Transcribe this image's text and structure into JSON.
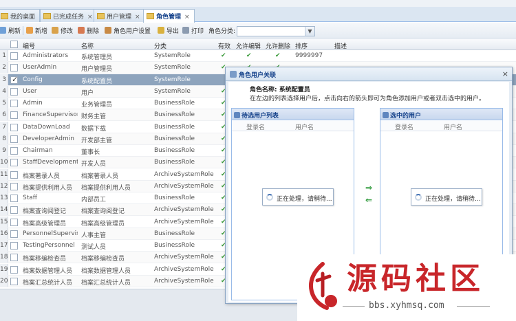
{
  "tabs": [
    {
      "label": "我的桌面",
      "closable": false
    },
    {
      "label": "已完成任务",
      "closable": true
    },
    {
      "label": "用户管理",
      "closable": true
    },
    {
      "label": "角色管理",
      "closable": true,
      "active": true
    }
  ],
  "toolbar": {
    "refresh": "刷新",
    "add": "新增",
    "edit": "修改",
    "delete": "删除",
    "role_user_settings": "角色用户设置",
    "export": "导出",
    "print": "打印",
    "category_label": "角色分类:",
    "category_value": ""
  },
  "grid": {
    "columns": {
      "code": "编号",
      "name": "名称",
      "category": "分类",
      "enabled": "有效",
      "allow_edit": "允许编辑",
      "allow_delete": "允许删除",
      "sort": "排序",
      "description": "描述"
    },
    "rows": [
      {
        "num": "1",
        "code": "Administrators",
        "name": "系统管理员",
        "category": "SystemRole",
        "enabled": "✔",
        "allow_edit": "✔",
        "allow_delete": "✔",
        "sort": "9999997",
        "description": ""
      },
      {
        "num": "2",
        "code": "UserAdmin",
        "name": "用户管理员",
        "category": "SystemRole",
        "enabled": "✔",
        "allow_edit": "✔",
        "allow_delete": "✔",
        "sort": "",
        "description": ""
      },
      {
        "num": "3",
        "code": "Config",
        "name": "系统配置员",
        "category": "SystemRole",
        "enabled": "",
        "allow_edit": "",
        "allow_delete": "",
        "sort": "",
        "description": "",
        "selected": true
      },
      {
        "num": "4",
        "code": "User",
        "name": "用户",
        "category": "SystemRole",
        "enabled": "✔",
        "allow_edit": "",
        "allow_delete": "",
        "sort": "",
        "description": ""
      },
      {
        "num": "5",
        "code": "Admin",
        "name": "业务管理员",
        "category": "BusinessRole",
        "enabled": "✔",
        "allow_edit": "",
        "allow_delete": "",
        "sort": "",
        "description": ""
      },
      {
        "num": "6",
        "code": "FinanceSupervisor",
        "name": "财务主管",
        "category": "BusinessRole",
        "enabled": "✔",
        "allow_edit": "",
        "allow_delete": "",
        "sort": "",
        "description": ""
      },
      {
        "num": "7",
        "code": "DataDownLoad",
        "name": "数据下载",
        "category": "BusinessRole",
        "enabled": "✔",
        "allow_edit": "",
        "allow_delete": "",
        "sort": "",
        "description": ""
      },
      {
        "num": "8",
        "code": "DeveloperAdmin",
        "name": "开发部主管",
        "category": "BusinessRole",
        "enabled": "✔",
        "allow_edit": "",
        "allow_delete": "",
        "sort": "",
        "description": ""
      },
      {
        "num": "9",
        "code": "Chairman",
        "name": "董事长",
        "category": "BusinessRole",
        "enabled": "✔",
        "allow_edit": "",
        "allow_delete": "",
        "sort": "",
        "description": ""
      },
      {
        "num": "10",
        "code": "StaffDevelopment",
        "name": "开发人员",
        "category": "BusinessRole",
        "enabled": "✔",
        "allow_edit": "",
        "allow_delete": "",
        "sort": "",
        "description": ""
      },
      {
        "num": "11",
        "code": "档案著录人员",
        "name": "档案著录人员",
        "category": "ArchiveSystemRole",
        "enabled": "✔",
        "allow_edit": "",
        "allow_delete": "",
        "sort": "",
        "description": ""
      },
      {
        "num": "12",
        "code": "档案提供利用人员",
        "name": "档案提供利用人员",
        "category": "ArchiveSystemRole",
        "enabled": "✔",
        "allow_edit": "",
        "allow_delete": "",
        "sort": "",
        "description": ""
      },
      {
        "num": "13",
        "code": "Staff",
        "name": "内部员工",
        "category": "BusinessRole",
        "enabled": "✔",
        "allow_edit": "",
        "allow_delete": "",
        "sort": "",
        "description": ""
      },
      {
        "num": "14",
        "code": "档案查询阅登记",
        "name": "档案查询阅登记",
        "category": "ArchiveSystemRole",
        "enabled": "✔",
        "allow_edit": "",
        "allow_delete": "",
        "sort": "",
        "description": ""
      },
      {
        "num": "15",
        "code": "档案高级管理员",
        "name": "档案高级管理员",
        "category": "ArchiveSystemRole",
        "enabled": "✔",
        "allow_edit": "",
        "allow_delete": "",
        "sort": "",
        "description": ""
      },
      {
        "num": "16",
        "code": "PersonnelSupervisor",
        "name": "人事主管",
        "category": "BusinessRole",
        "enabled": "✔",
        "allow_edit": "",
        "allow_delete": "",
        "sort": "",
        "description": ""
      },
      {
        "num": "17",
        "code": "TestingPersonnel",
        "name": "测试人员",
        "category": "BusinessRole",
        "enabled": "✔",
        "allow_edit": "",
        "allow_delete": "",
        "sort": "",
        "description": ""
      },
      {
        "num": "18",
        "code": "档案移编检查员",
        "name": "档案移编检查员",
        "category": "ArchiveSystemRole",
        "enabled": "✔",
        "allow_edit": "",
        "allow_delete": "",
        "sort": "",
        "description": ""
      },
      {
        "num": "19",
        "code": "档案数据管理人员",
        "name": "档案数据管理人员",
        "category": "ArchiveSystemRole",
        "enabled": "✔",
        "allow_edit": "",
        "allow_delete": "",
        "sort": "",
        "description": ""
      },
      {
        "num": "20",
        "code": "档案汇总统计人员",
        "name": "档案汇总统计人员",
        "category": "ArchiveSystemRole",
        "enabled": "✔",
        "allow_edit": "",
        "allow_delete": "",
        "sort": "",
        "description": ""
      }
    ]
  },
  "dialog": {
    "title": "角色用户关联",
    "role_name": "角色名称: 系统配置员",
    "instructions": "在左边的列表选择用户后，点击向右的箭头即可为角色添加用户或者双击选中的用户。",
    "left_panel": {
      "title": "待选用户列表",
      "col_login": "登录名",
      "col_username": "用户名",
      "loading": "正在处理，请稍待..."
    },
    "right_panel": {
      "title": "选中的用户",
      "col_login": "登录名",
      "col_username": "用户名",
      "loading": "正在处理，请稍待..."
    },
    "add_arrow": "⇒",
    "remove_arrow": "⇐"
  },
  "watermark": {
    "big": "源码社区",
    "url": "bbs.xyhmsq.com"
  },
  "colors": {
    "selected_row": "#8ea4bd",
    "check": "#3a9a3a",
    "title_blue": "#15428b",
    "watermark_red": "#c8262a"
  }
}
